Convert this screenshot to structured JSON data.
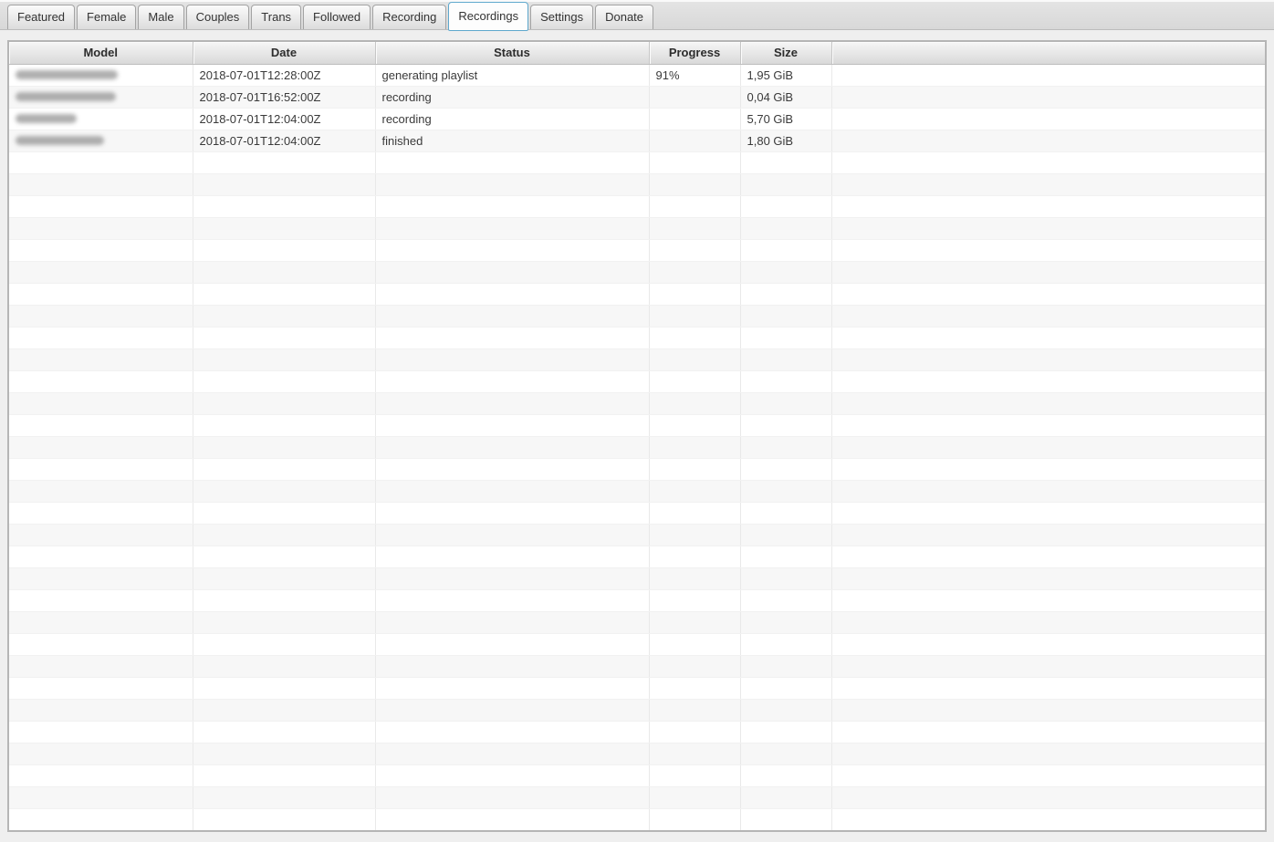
{
  "colors": {
    "active_tab_border": "#5fa8cd",
    "tab_strip_bg": "#dcdcdc",
    "header_gradient_top": "#f6f6f6",
    "header_gradient_bottom": "#d9d9d9",
    "row_stripe": "#f7f7f7",
    "text": "#3a3a3a"
  },
  "tabs": {
    "items": [
      {
        "label": "Featured",
        "active": false
      },
      {
        "label": "Female",
        "active": false
      },
      {
        "label": "Male",
        "active": false
      },
      {
        "label": "Couples",
        "active": false
      },
      {
        "label": "Trans",
        "active": false
      },
      {
        "label": "Followed",
        "active": false
      },
      {
        "label": "Recording",
        "active": false
      },
      {
        "label": "Recordings",
        "active": true
      },
      {
        "label": "Settings",
        "active": false
      },
      {
        "label": "Donate",
        "active": false
      }
    ]
  },
  "table": {
    "columns": [
      "Model",
      "Date",
      "Status",
      "Progress",
      "Size",
      ""
    ],
    "rows": [
      {
        "model": "",
        "model_redacted": true,
        "date": "2018-07-01T12:28:00Z",
        "status": "generating playlist",
        "progress": "91%",
        "size": "1,95 GiB"
      },
      {
        "model": "",
        "model_redacted": true,
        "date": "2018-07-01T16:52:00Z",
        "status": "recording",
        "progress": "",
        "size": "0,04 GiB"
      },
      {
        "model": "",
        "model_redacted": true,
        "date": "2018-07-01T12:04:00Z",
        "status": "recording",
        "progress": "",
        "size": "5,70 GiB"
      },
      {
        "model": "",
        "model_redacted": true,
        "date": "2018-07-01T12:04:00Z",
        "status": "finished",
        "progress": "",
        "size": "1,80 GiB"
      }
    ],
    "empty_row_count": 31
  }
}
